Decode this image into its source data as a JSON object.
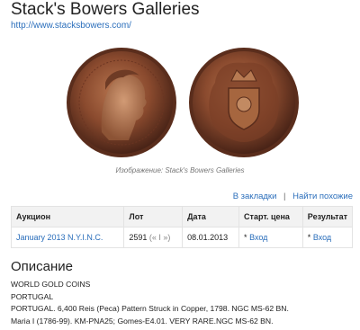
{
  "header": {
    "title": "Stack's Bowers Galleries",
    "url": "http://www.stacksbowers.com/"
  },
  "image": {
    "caption": "Изображение: Stack's Bowers Galleries"
  },
  "actions": {
    "bookmarks": "В закладки",
    "separator": "|",
    "find_similar": "Найти похожие"
  },
  "table": {
    "headers": [
      "Аукцион",
      "Лот",
      "Дата",
      "Старт. цена",
      "Результат"
    ],
    "row": {
      "auction": "January 2013 N.Y.I.N.C.",
      "lot": "2591",
      "lot_nav": "(« I »)",
      "date": "08.01.2013",
      "start_price_marker": "*",
      "start_price_link": "Вход",
      "result_marker": "*",
      "result_link": "Вход"
    }
  },
  "description": {
    "heading": "Описание",
    "lines": [
      "WORLD GOLD COINS",
      "PORTUGAL",
      "PORTUGAL. 6,400 Reis (Peca) Pattern Struck in Copper, 1798. NGC MS-62 BN.",
      "Maria I (1786-99). KM-PNA25; Gomes-E4.01. VERY RARE.NGC MS-62 BN."
    ]
  },
  "colors": {
    "link": "#2a6ebb",
    "copper": "#8a4a2e",
    "table_header_bg": "#f2f2f2"
  }
}
